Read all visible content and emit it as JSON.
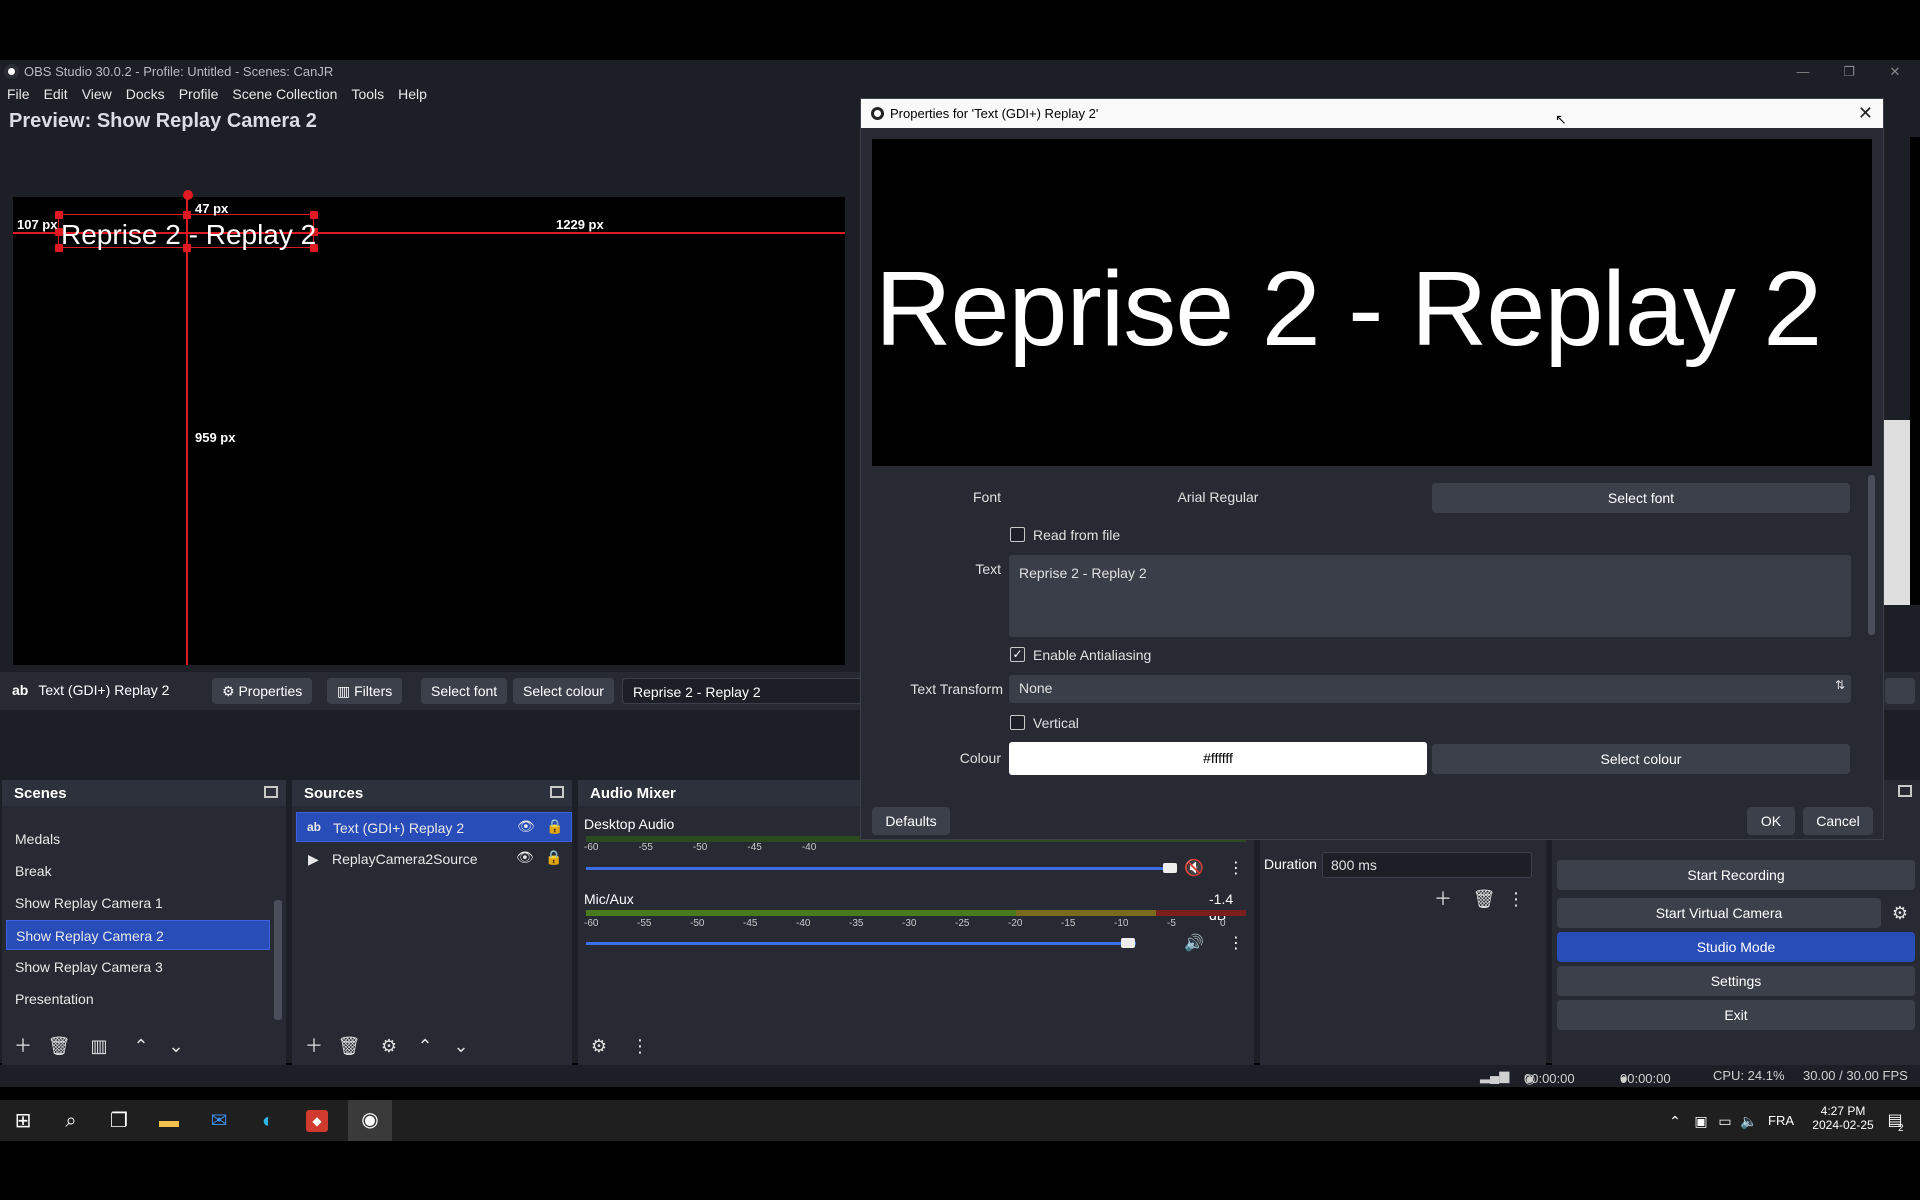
{
  "window": {
    "title": "OBS Studio 30.0.2 - Profile: Untitled - Scenes: CanJR",
    "minimize": "—",
    "maximize": "❐",
    "close": "✕"
  },
  "menu": [
    "File",
    "Edit",
    "View",
    "Docks",
    "Profile",
    "Scene Collection",
    "Tools",
    "Help"
  ],
  "preview": {
    "label": "Preview: Show Replay Camera 2",
    "canvas_text": "Reprise 2 - Replay 2",
    "dims": {
      "left": "107 px",
      "top": "47 px",
      "right": "1229 px",
      "bottom": "959 px"
    }
  },
  "source_toolbar": {
    "source_name": "Text (GDI+) Replay 2",
    "properties": "Properties",
    "filters": "Filters",
    "select_font": "Select font",
    "select_colour": "Select colour",
    "text_value": "Reprise 2 - Replay 2"
  },
  "scenes": {
    "title": "Scenes",
    "items": [
      "Medals",
      "Break",
      "Show Replay Camera 1",
      "Show Replay Camera 2",
      "Show Replay Camera 3",
      "Presentation"
    ],
    "selected": "Show Replay Camera 2"
  },
  "sources": {
    "title": "Sources",
    "items": [
      {
        "name": "Text (GDI+) Replay 2",
        "type_icon": "ab"
      },
      {
        "name": "ReplayCamera2Source",
        "type_icon": "▶"
      }
    ]
  },
  "audio_mixer": {
    "title": "Audio Mixer",
    "channels": [
      {
        "name": "Desktop Audio",
        "db": "",
        "muted": true,
        "volume": 0.98
      },
      {
        "name": "Mic/Aux",
        "db": "-1.4 dB",
        "muted": false,
        "volume": 0.9
      }
    ],
    "ticks": [
      "-60",
      "-55",
      "-50",
      "-45",
      "-40",
      "-35",
      "-30",
      "-25",
      "-20",
      "-15",
      "-10",
      "-5",
      "0"
    ]
  },
  "transitions": {
    "duration_label": "Duration",
    "duration_value": "800 ms"
  },
  "controls": {
    "start_recording": "Start Recording",
    "start_virtual_camera": "Start Virtual Camera",
    "studio_mode": "Studio Mode",
    "settings": "Settings",
    "exit": "Exit"
  },
  "status": {
    "stream_time": "00:00:00",
    "rec_time": "00:00:00",
    "cpu": "CPU: 24.1%",
    "fps": "30.00 / 30.00 FPS"
  },
  "taskbar": {
    "lang": "FRA",
    "time": "4:27 PM",
    "date": "2024-02-25",
    "notif_count": "2"
  },
  "dialog": {
    "title": "Properties for 'Text (GDI+) Replay 2'",
    "preview_text": "Reprise 2 - Replay 2",
    "font_label": "Font",
    "font_value": "Arial Regular",
    "select_font": "Select font",
    "read_from_file": "Read from file",
    "text_label": "Text",
    "text_value": "Reprise 2 - Replay 2",
    "antialiasing": "Enable Antialiasing",
    "text_transform_label": "Text Transform",
    "text_transform_value": "None",
    "vertical": "Vertical",
    "colour_label": "Colour",
    "colour_value": "#ffffff",
    "select_colour": "Select colour",
    "defaults": "Defaults",
    "ok": "OK",
    "cancel": "Cancel"
  },
  "colors": {
    "accent": "#284cb8",
    "guide_red": "#e01a22",
    "panel_bg": "#272a33"
  }
}
